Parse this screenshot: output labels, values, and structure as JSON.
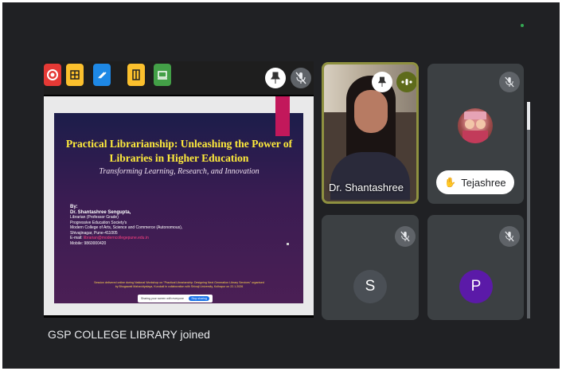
{
  "colors": {
    "frame_bg": "#202124",
    "speaking_border": "#8f9140",
    "slide_title": "#ffeb3b",
    "avatar_s": "#3c4043",
    "avatar_p": "#5b1aa8"
  },
  "presentation": {
    "app_icons": [
      "record-icon",
      "grid-icon",
      "pencil-icon",
      "panel-icon",
      "document-icon"
    ],
    "slide": {
      "title_line1": "Practical Librarianship: Unleashing the Power of",
      "title_line2": "Libraries in Higher Education",
      "subtitle": "Transforming Learning, Research, and Innovation",
      "by": "By:",
      "author": "Dr. Shantashree Sengupta,",
      "role": "Librarian (Professor Grade)",
      "org": "Progressive Education Society's",
      "college": "Modern College of Arts, Science and Commerce (Autonomous),",
      "address": "Shivajinagar, Pune-411005",
      "email_label": "E-mail:",
      "email": "librarian@moderncollegepune.edu.in",
      "mobile": "Mobile: 9860000420",
      "note_line1": "Session delivered online during National Workshop on \"Practical Librarianship: Designing Next Generation Library Services\" organised",
      "note_line2": "by Bhogawati Mahavidyalaya, Kurukali in collaboration with Shivaji University, Kolhapur on 22.1.2026",
      "chip_text": "Sharing your screen with everyone",
      "chip_button": "Stop sharing"
    }
  },
  "participants": [
    {
      "name": "Dr. Shantashree",
      "speaking": true
    },
    {
      "name": "Tejashree",
      "hand_raised": true,
      "muted": true
    },
    {
      "initial": "S",
      "muted": true
    },
    {
      "initial": "P",
      "muted": true
    }
  ],
  "toast": "GSP COLLEGE LIBRARY joined"
}
